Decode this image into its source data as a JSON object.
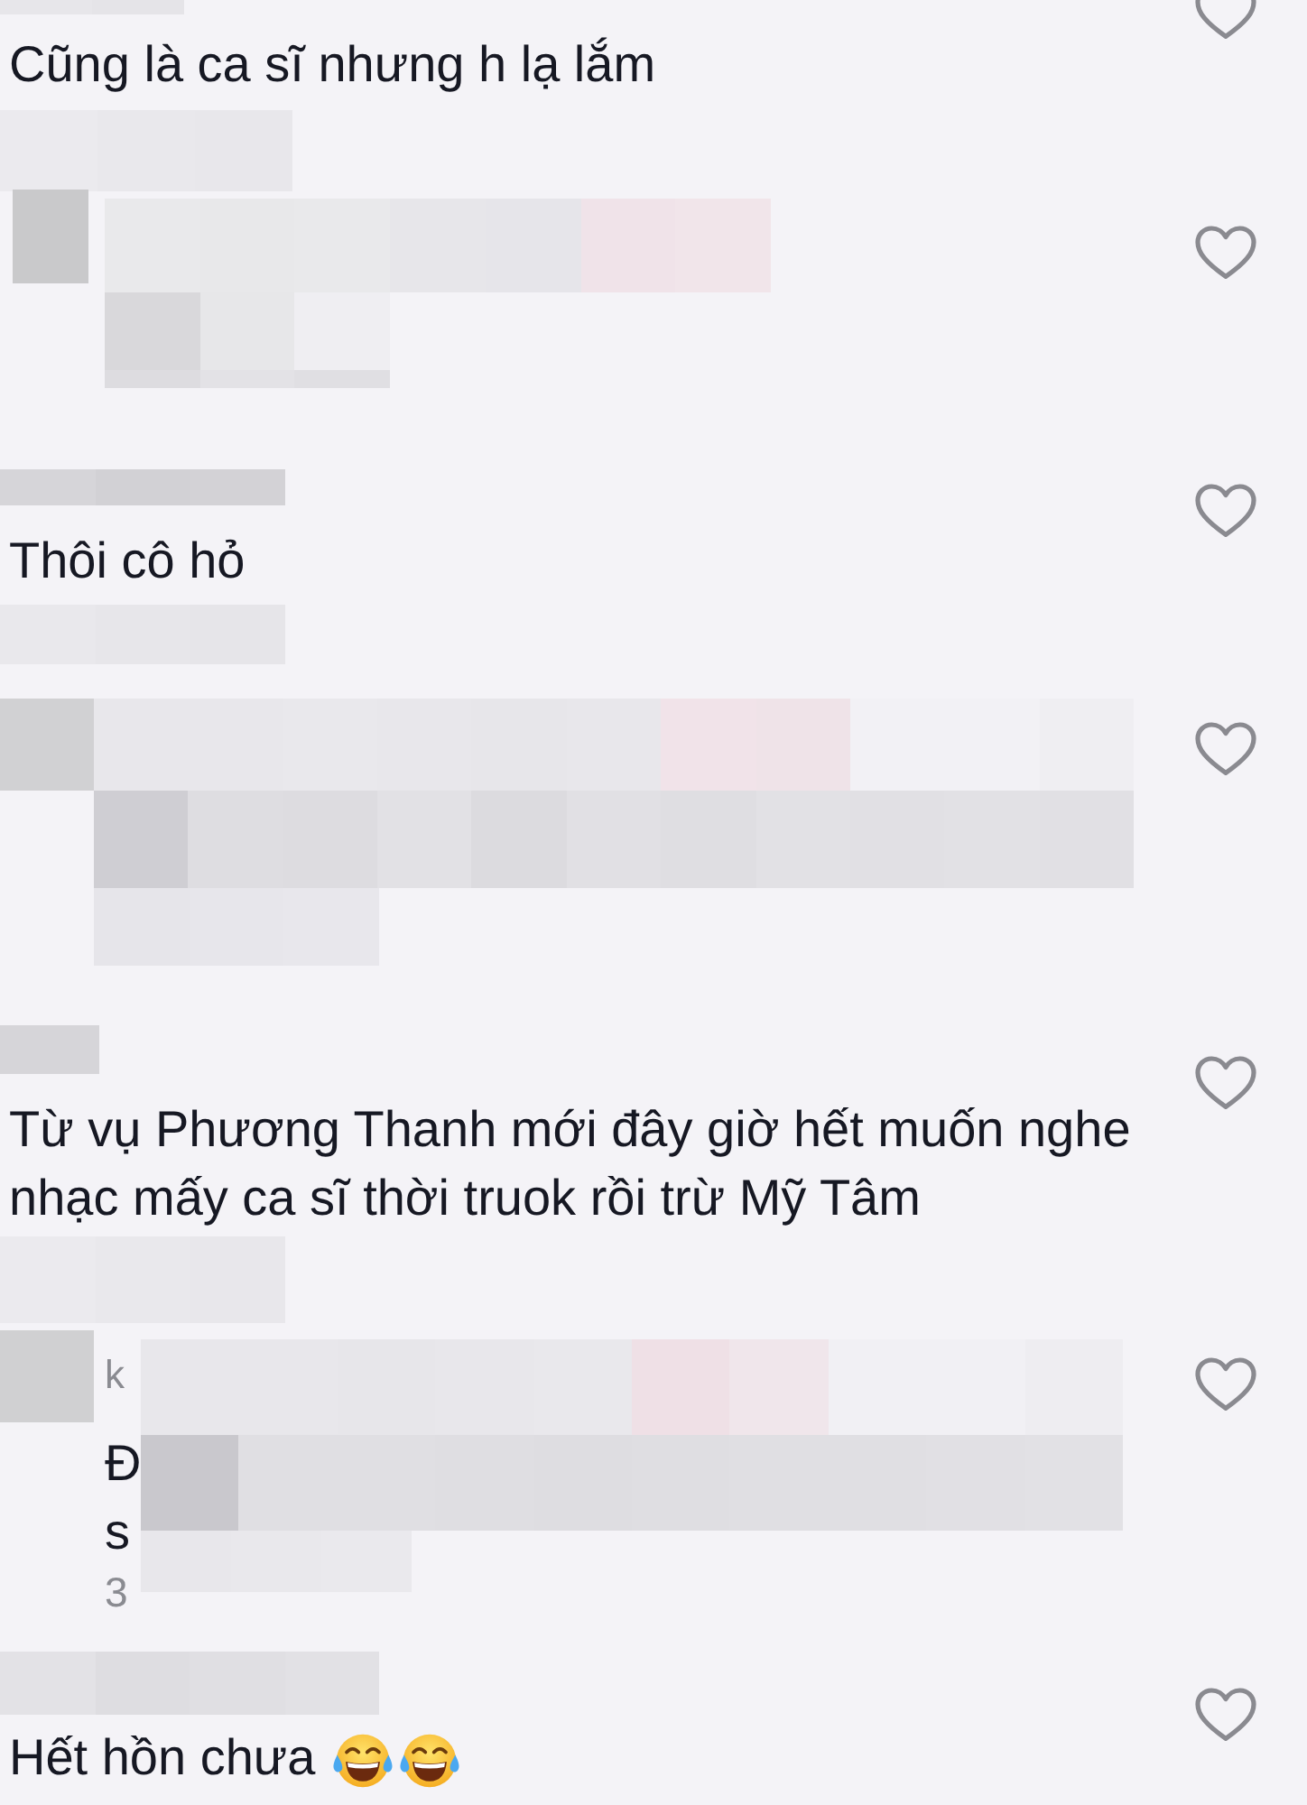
{
  "comments": [
    {
      "kind": "comment",
      "name_pixelated": true,
      "text": "Cũng là ca sĩ nhưng h lạ lắm",
      "meta_pixelated": true,
      "liked": false
    },
    {
      "kind": "reply",
      "pixelated": true,
      "liked": false
    },
    {
      "kind": "comment",
      "name_pixelated": true,
      "text": "Thôi cô hỏ",
      "meta_pixelated": true,
      "liked": false
    },
    {
      "kind": "reply",
      "pixelated": true,
      "liked": false
    },
    {
      "kind": "comment",
      "name_pixelated": true,
      "text": "Từ vụ Phương Thanh mới đây giờ hết muốn nghe nhạc mấy ca sĩ thời truok rồi trừ Mỹ Tâm",
      "meta_pixelated": true,
      "liked": false
    },
    {
      "kind": "reply",
      "pixelated": true,
      "username": "k",
      "text_lines": [
        "Đ",
        "s"
      ],
      "time": "3",
      "liked": false
    },
    {
      "kind": "comment",
      "name_pixelated": true,
      "text": "Hết hồn chưa",
      "emojis": [
        {
          "kind": "tears-of-joy"
        },
        {
          "kind": "tears-of-joy"
        }
      ],
      "liked": false
    }
  ]
}
